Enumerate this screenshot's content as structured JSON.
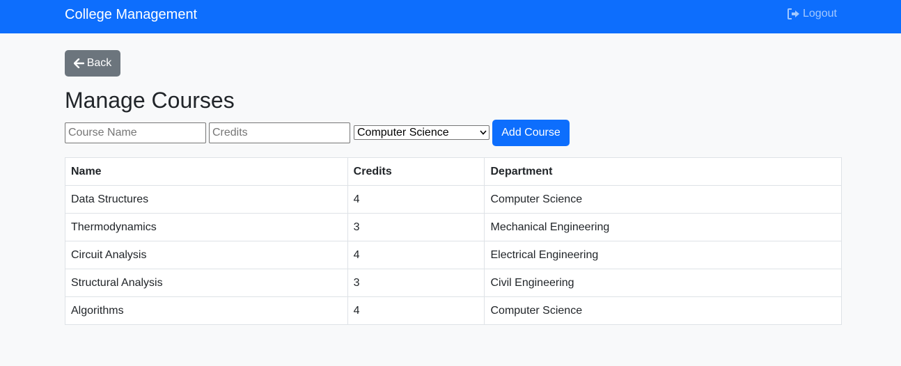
{
  "navbar": {
    "brand": "College Management",
    "logout_label": "Logout",
    "background": "#0d6efd"
  },
  "back_button": {
    "label": "Back",
    "icon": "arrow-left-icon"
  },
  "page": {
    "title": "Manage Courses"
  },
  "form": {
    "course_name_placeholder": "Course Name",
    "course_name_value": "",
    "credits_placeholder": "Credits",
    "credits_value": "",
    "department_selected": "Computer Science",
    "add_button_label": "Add Course"
  },
  "table": {
    "headers": [
      "Name",
      "Credits",
      "Department"
    ],
    "rows": [
      {
        "name": "Data Structures",
        "credits": "4",
        "department": "Computer Science"
      },
      {
        "name": "Thermodynamics",
        "credits": "3",
        "department": "Mechanical Engineering"
      },
      {
        "name": "Circuit Analysis",
        "credits": "4",
        "department": "Electrical Engineering"
      },
      {
        "name": "Structural Analysis",
        "credits": "3",
        "department": "Civil Engineering"
      },
      {
        "name": "Algorithms",
        "credits": "4",
        "department": "Computer Science"
      }
    ]
  },
  "colors": {
    "primary": "#0d6efd",
    "secondary": "#6c757d",
    "page_background": "#f8f9fa"
  }
}
